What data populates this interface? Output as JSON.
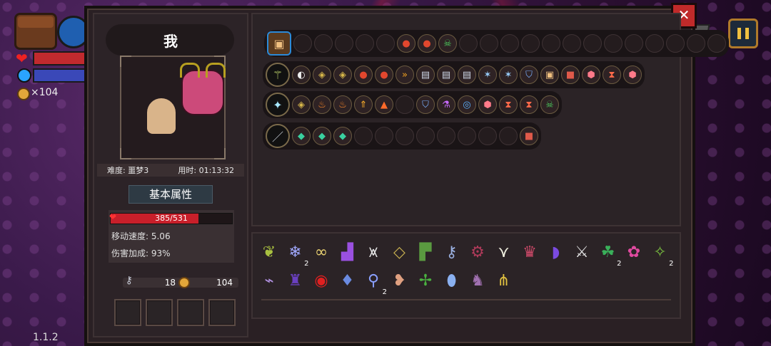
{
  "hud": {
    "coins": "×104",
    "version": "1.1.2"
  },
  "character": {
    "name": "我",
    "difficulty": "难度: 噩梦3",
    "time": "用时: 01:13:32",
    "section_title": "基本属性",
    "hp": "385/531",
    "hp_fraction": 0.725,
    "move_speed": "移动速度: 5.06",
    "damage_bonus": "伤害加成: 93%",
    "keys": "18",
    "coins": "104",
    "empty_slots": 4
  },
  "weapon_rows": [
    {
      "weapon_icon": "chest-icon",
      "mods": [
        "",
        "",
        "",
        "",
        "",
        "bomb-icon",
        "bomb-icon",
        "skull-icon",
        "",
        "",
        "",
        "",
        "",
        "",
        "",
        "",
        "",
        "",
        "",
        "",
        ""
      ]
    },
    {
      "weapon_icon": "staff-icon",
      "mods": [
        "mouse-icon",
        "rune-icon",
        "rune-icon",
        "bomb-icon",
        "bomb-icon",
        "arrows-icon",
        "book-icon",
        "book-icon",
        "book-icon",
        "star-icon",
        "star-icon",
        "shield-icon",
        "chest-icon",
        "cube-icon",
        "hex-icon",
        "hourglass-icon",
        "hex-icon"
      ]
    },
    {
      "weapon_icon": "wand-icon",
      "mods": [
        "rune-icon",
        "flame-icon",
        "flame-icon",
        "up-arrow-icon",
        "tri-icon",
        "",
        "shield-icon",
        "potion-icon",
        "swirl-icon",
        "hex-icon",
        "hourglass-icon",
        "hourglass-icon",
        "skull-icon"
      ]
    },
    {
      "weapon_icon": "spear-icon",
      "mods": [
        "gem-icon",
        "gem-icon",
        "gem-icon",
        "",
        "",
        "",
        "",
        "",
        "",
        "",
        "",
        "cube-icon"
      ]
    }
  ],
  "items": [
    {
      "name": "leaf-icon",
      "count": ""
    },
    {
      "name": "crystal-icon",
      "count": "2"
    },
    {
      "name": "glasses-icon",
      "count": ""
    },
    {
      "name": "boot-icon",
      "count": ""
    },
    {
      "name": "jaw-icon",
      "count": ""
    },
    {
      "name": "rune-stone-icon",
      "count": ""
    },
    {
      "name": "sock-icon",
      "count": ""
    },
    {
      "name": "key-icon",
      "count": ""
    },
    {
      "name": "cog-icon",
      "count": ""
    },
    {
      "name": "wing-icon",
      "count": ""
    },
    {
      "name": "cloak-icon",
      "count": ""
    },
    {
      "name": "cape-icon",
      "count": ""
    },
    {
      "name": "sword-icon",
      "count": ""
    },
    {
      "name": "clover-icon",
      "count": "2"
    },
    {
      "name": "flower-icon",
      "count": ""
    },
    {
      "name": "sprout-icon",
      "count": "2"
    },
    {
      "name": "bone-icon",
      "count": ""
    },
    {
      "name": "robe-icon",
      "count": ""
    },
    {
      "name": "eye-icon",
      "count": ""
    },
    {
      "name": "drop-icon",
      "count": ""
    },
    {
      "name": "magnifier-icon",
      "count": "2"
    },
    {
      "name": "meat-icon",
      "count": ""
    },
    {
      "name": "twig-icon",
      "count": ""
    },
    {
      "name": "egg-icon",
      "count": ""
    },
    {
      "name": "armor-icon",
      "count": ""
    },
    {
      "name": "claw-icon",
      "count": ""
    }
  ],
  "colors": {
    "hp": "#c81f2a",
    "mp": "#3a48b8",
    "panel": "#2a2024",
    "close": "#c02a2a",
    "accent": "#f0c040"
  }
}
